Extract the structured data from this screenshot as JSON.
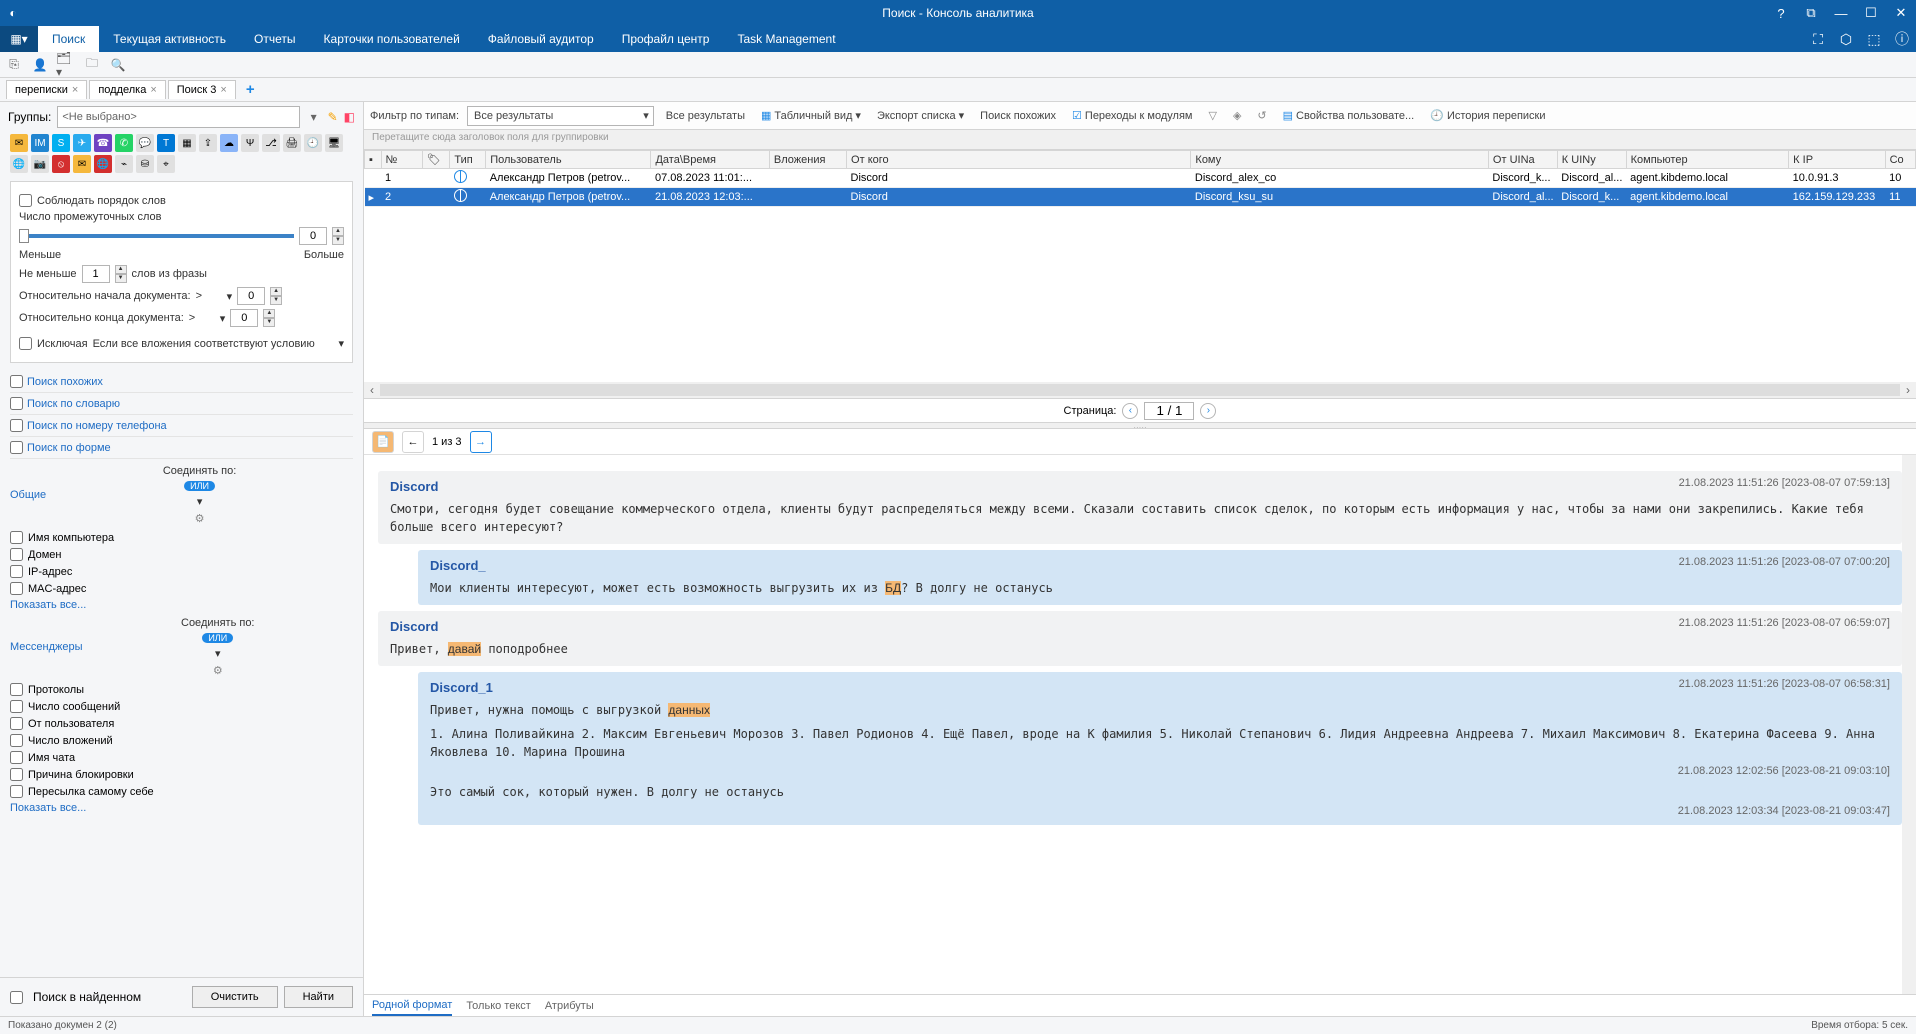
{
  "title": "Поиск - Консоль аналитика",
  "ribbon": {
    "tabs": [
      "Поиск",
      "Текущая активность",
      "Отчеты",
      "Карточки пользователей",
      "Файловый аудитор",
      "Профайл центр",
      "Task Management"
    ]
  },
  "innerTabs": {
    "t0": "переписки",
    "t1": "подделка",
    "t2": "Поиск 3"
  },
  "groups": {
    "label": "Группы:",
    "placeholder": "<Не выбрано>"
  },
  "cfg": {
    "order": "Соблюдать порядок слов",
    "gapLabel": "Число промежуточных слов",
    "gapVal": "0",
    "less": "Меньше",
    "more": "Больше",
    "minLabel": "Не меньше",
    "minVal": "1",
    "minSuffix": "слов из фразы",
    "docStart": "Относительно начала документа:",
    "docEnd": "Относительно конца документа:",
    "sv": "0",
    "op": ">",
    "excl": "Исключая",
    "exclCombo": "Если все вложения соответствуют условию"
  },
  "llist": {
    "l0": "Поиск похожих",
    "l1": "Поиск по словарю",
    "l2": "Поиск по номеру телефона",
    "l3": "Поиск по форме"
  },
  "sections": {
    "general": "Общие",
    "msg": "Мессенджеры",
    "connect": "Соединять по:",
    "or": "ИЛИ"
  },
  "gen": {
    "c0": "Имя компьютера",
    "c1": "Домен",
    "c2": "IP-адрес",
    "c3": "MAC-адрес",
    "show": "Показать все..."
  },
  "im": {
    "c0": "Протоколы",
    "c1": "Число сообщений",
    "c2": "От пользователя",
    "c3": "Число вложений",
    "c4": "Имя чата",
    "c5": "Причина блокировки",
    "c6": "Пересылка самому себе",
    "show": "Показать все..."
  },
  "bottom": {
    "inFound": "Поиск в найденном",
    "clear": "Очистить",
    "find": "Найти"
  },
  "filterBar": {
    "byType": "Фильтр по типам:",
    "allRes": "Все результаты",
    "allRes2": "Все результаты",
    "tableView": "Табличный вид",
    "export": "Экспорт списка",
    "similar": "Поиск похожих",
    "modules": "Переходы к модулям",
    "userProps": "Свойства пользовате...",
    "history": "История переписки"
  },
  "groupHint": "Перетащите сюда заголовок поля для группировки",
  "cols": {
    "n": "№",
    "t": "Тип",
    "u": "Пользователь",
    "d": "Дата\\Время",
    "a": "Вложения",
    "f": "От кого",
    "to": "Кому",
    "fu": "От UINa",
    "tu": "К UINy",
    "pc": "Компьютер",
    "ip": "К IP",
    "co": "Со"
  },
  "rows": [
    {
      "n": "1",
      "u": "Александр Петров (petrov...",
      "d": "07.08.2023 11:01:...",
      "f": "Discord",
      "to": "Discord_alex_co",
      "fu": "Discord_k...",
      "tu": "Discord_al...",
      "pc": "agent.kibdemo.local",
      "ip": "10.0.91.3",
      "co": "10"
    },
    {
      "n": "2",
      "u": "Александр Петров (petrov...",
      "d": "21.08.2023 12:03:...",
      "f": "Discord",
      "to": "Discord_ksu_su",
      "fu": "Discord_al...",
      "tu": "Discord_k...",
      "pc": "agent.kibdemo.local",
      "ip": "162.159.129.233",
      "co": "11"
    }
  ],
  "pager": {
    "label": "Страница:",
    "val": "1 / 1"
  },
  "previewTb": {
    "pos": "1 из 3"
  },
  "msgs": [
    {
      "cls": "light",
      "from": "Discord",
      "ts": "21.08.2023 11:51:26 [2023-08-07 07:59:13]",
      "body": "Смотри, сегодня будет совещание коммерческого отдела, клиенты будут распределяться между всеми. Сказали составить список сделок, по которым есть информация у нас, чтобы за нами они закрепились. Какие тебя больше всего интересуют?"
    },
    {
      "cls": "blue",
      "from": "Discord_",
      "ts": "21.08.2023 11:51:26 [2023-08-07 07:00:20]",
      "body": "Мои клиенты интересуют, может есть возможность выгрузить их из <hl>БД</hl>? В долгу не останусь"
    },
    {
      "cls": "light",
      "from": "Discord",
      "ts": "21.08.2023 11:51:26 [2023-08-07 06:59:07]",
      "body": "Привет, <hl>давай</hl> поподробнее"
    },
    {
      "cls": "blue",
      "from": "Discord_1",
      "ts": "21.08.2023 11:51:26 [2023-08-07 06:58:31]",
      "body": "Привет, нужна помощь с выгрузкой <hl>данных</hl>",
      "extra": [
        "1. Алина Поливайкина  2. Максим Евгеньевич Морозов  3. Павел Родионов  4. Ещё Павел, вроде на К фамилия  5. Николай Степанович  6. Лидия Андреевна Андреева  7. Михаил Максимович   8. Екатерина Фасеева   9. Анна Яковлева  10. Марина Прошина",
        "Это самый сок, который нужен. В долгу не останусь"
      ],
      "extraTs": [
        "21.08.2023 12:02:56 [2023-08-21 09:03:10]",
        "21.08.2023 12:03:34 [2023-08-21 09:03:47]"
      ]
    }
  ],
  "ftabs": {
    "t0": "Родной формат",
    "t1": "Только текст",
    "t2": "Атрибуты"
  },
  "status": {
    "left": "Показано докумен 2 (2)",
    "right": "Время отбора: 5 сек."
  }
}
